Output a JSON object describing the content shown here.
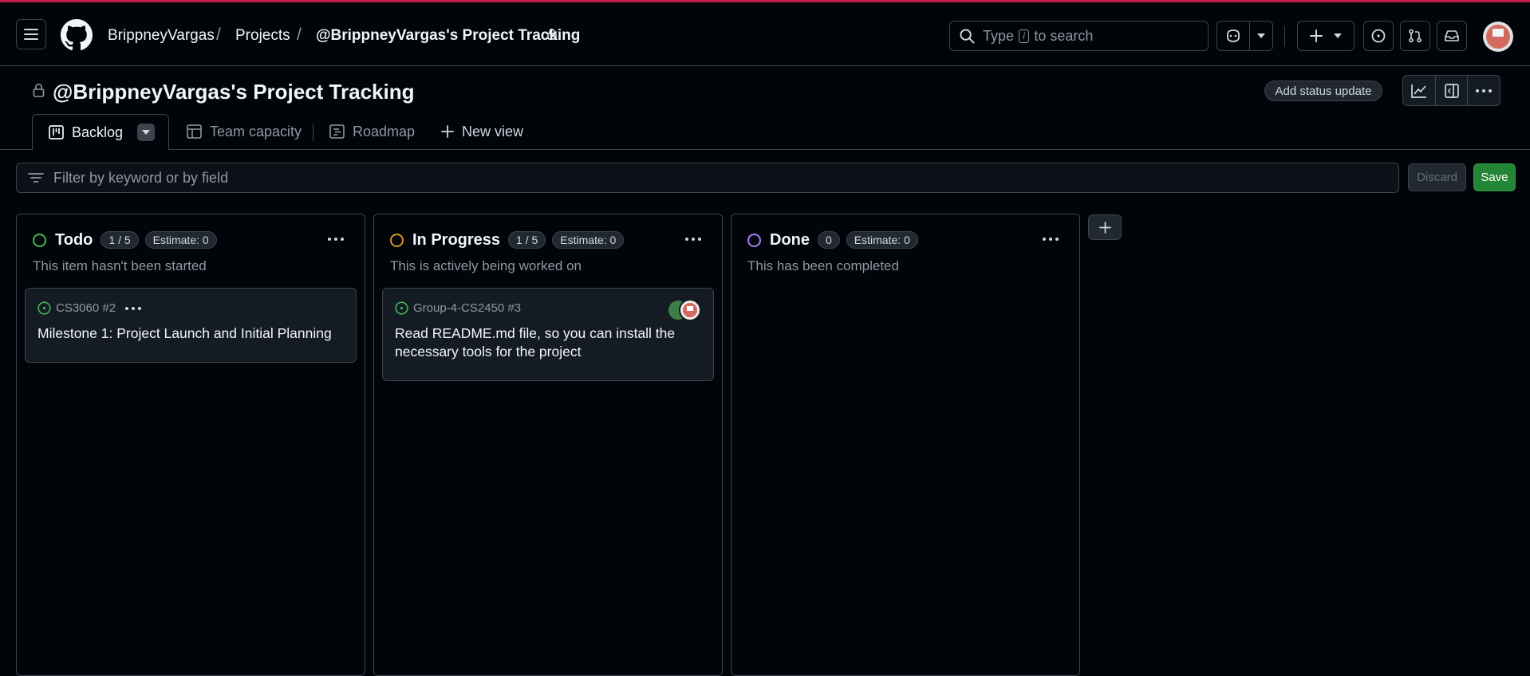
{
  "header": {
    "owner": "BrippneyVargas",
    "projects_link": "Projects",
    "project_link": "@BrippneyVargas's Project Tracking",
    "search_prefix": "Type",
    "search_key": "/",
    "search_suffix": "to search"
  },
  "project": {
    "title": "@BrippneyVargas's Project Tracking",
    "status_update_label": "Add status update"
  },
  "tabs": [
    {
      "label": "Backlog"
    },
    {
      "label": "Team capacity"
    },
    {
      "label": "Roadmap"
    },
    {
      "label": "New view"
    }
  ],
  "filter": {
    "placeholder": "Filter by keyword or by field",
    "discard_label": "Discard",
    "save_label": "Save"
  },
  "columns": [
    {
      "name": "Todo",
      "count": "1 / 5",
      "estimate": "Estimate: 0",
      "description": "This item hasn't been started",
      "color": "#3fb950",
      "cards": [
        {
          "repo": "CS3060 #2",
          "title": "Milestone 1: Project Launch and Initial Planning"
        }
      ]
    },
    {
      "name": "In Progress",
      "count": "1 / 5",
      "estimate": "Estimate: 0",
      "description": "This is actively being worked on",
      "color": "#d29922",
      "cards": [
        {
          "repo": "Group-4-CS2450 #3",
          "title": "Read README.md file, so you can install the necessary tools for the project"
        }
      ]
    },
    {
      "name": "Done",
      "count": "0",
      "estimate": "Estimate: 0",
      "description": "This has been completed",
      "color": "#ab7df8",
      "cards": []
    }
  ],
  "colors": {
    "accent_stripe": "#c21d4c",
    "background": "#010409",
    "save_green": "#238636"
  }
}
